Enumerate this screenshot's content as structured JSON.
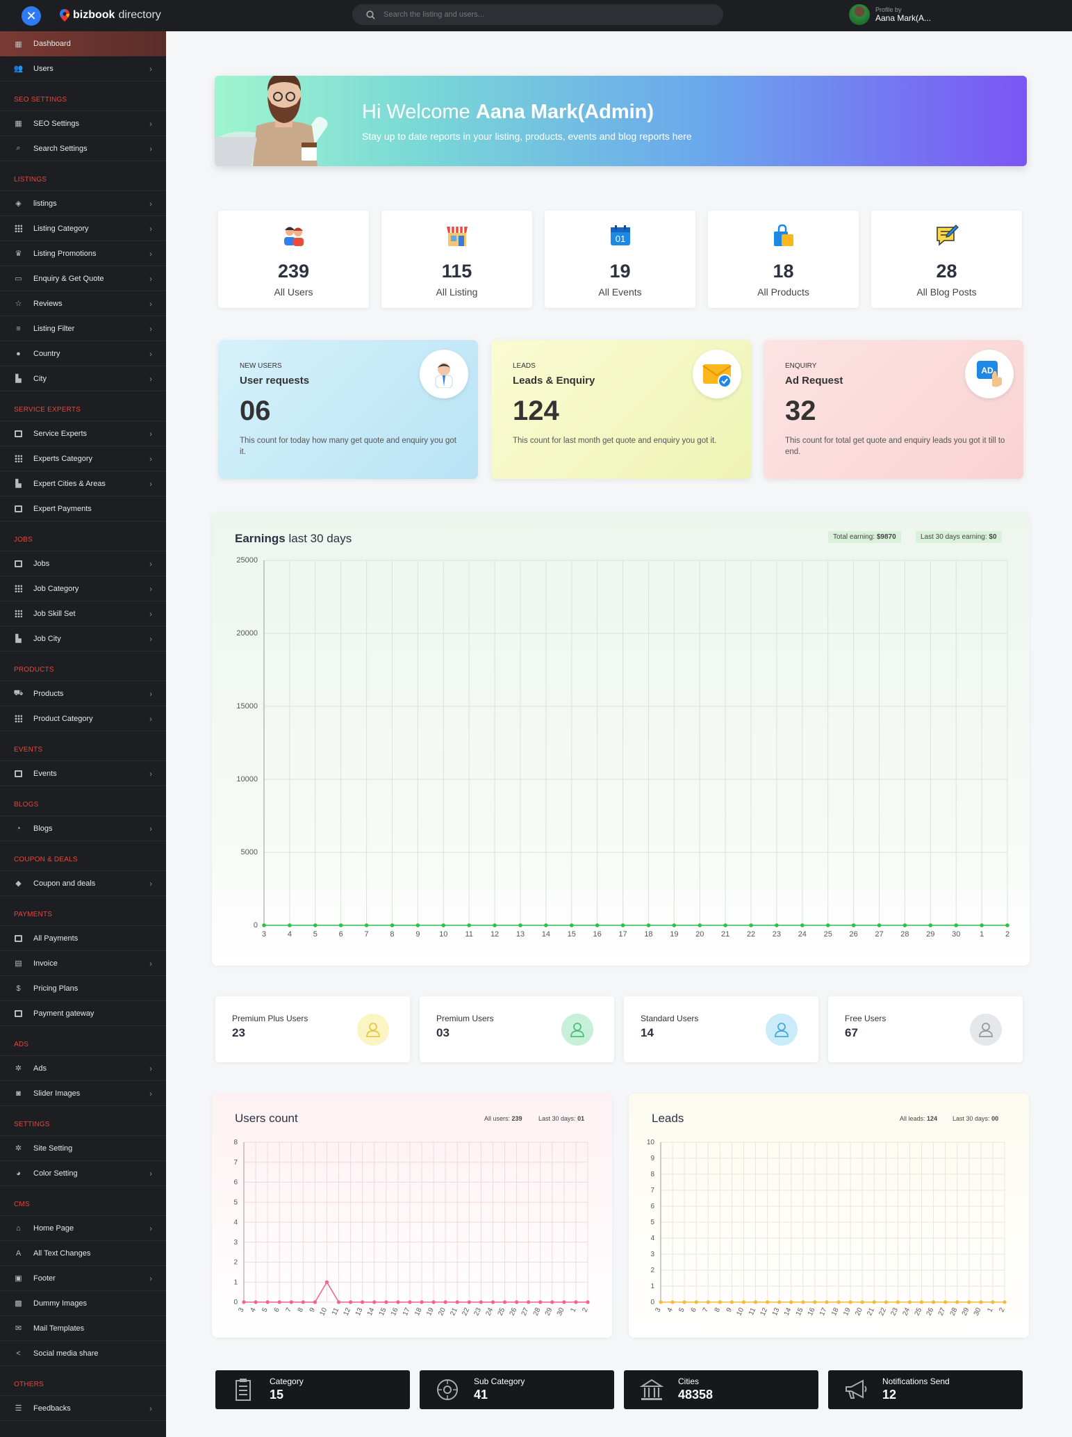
{
  "header": {
    "logo_bold": "bizbook",
    "logo_light": "directory",
    "search_placeholder": "Search the listing and users...",
    "profile_small": "Profile by",
    "profile_name": "Aana Mark(A..."
  },
  "sidebar": [
    {
      "label": "Dashboard",
      "icon": "dashboard-icon",
      "active": true
    },
    {
      "label": "Users",
      "icon": "users-icon",
      "chev": true
    },
    {
      "head": "SEO SETTINGS"
    },
    {
      "label": "SEO Settings",
      "icon": "seo-icon",
      "chev": true
    },
    {
      "label": "Search Settings",
      "icon": "search-settings-icon",
      "chev": true
    },
    {
      "head": "LISTINGS"
    },
    {
      "label": "listings",
      "icon": "layers-icon",
      "chev": true
    },
    {
      "label": "Listing Category",
      "icon": "grid-icon",
      "chev": true
    },
    {
      "label": "Listing Promotions",
      "icon": "trophy-icon",
      "chev": true
    },
    {
      "label": "Enquiry & Get Quote",
      "icon": "message-icon",
      "chev": true
    },
    {
      "label": "Reviews",
      "icon": "star-icon",
      "chev": true
    },
    {
      "label": "Listing Filter",
      "icon": "filter-icon",
      "chev": true
    },
    {
      "label": "Country",
      "icon": "location-icon",
      "chev": true
    },
    {
      "label": "City",
      "icon": "city-icon",
      "chev": true
    },
    {
      "head": "SERVICE EXPERTS"
    },
    {
      "label": "Service Experts",
      "icon": "calendar-icon",
      "chev": true
    },
    {
      "label": "Experts Category",
      "icon": "grid-icon",
      "chev": true
    },
    {
      "label": "Expert Cities & Areas",
      "icon": "city-icon",
      "chev": true
    },
    {
      "label": "Expert Payments",
      "icon": "card-icon",
      "chev": false
    },
    {
      "head": "JOBS"
    },
    {
      "label": "Jobs",
      "icon": "calendar-icon",
      "chev": true
    },
    {
      "label": "Job Category",
      "icon": "grid-icon",
      "chev": true
    },
    {
      "label": "Job Skill Set",
      "icon": "grid-icon",
      "chev": true
    },
    {
      "label": "Job City",
      "icon": "city-icon",
      "chev": true
    },
    {
      "head": "PRODUCTS"
    },
    {
      "label": "Products",
      "icon": "cart-icon",
      "chev": true
    },
    {
      "label": "Product Category",
      "icon": "grid-icon",
      "chev": true
    },
    {
      "head": "EVENTS"
    },
    {
      "label": "Events",
      "icon": "calendar-icon",
      "chev": true
    },
    {
      "head": "BLOGS"
    },
    {
      "label": "Blogs",
      "icon": "rss-icon",
      "chev": true
    },
    {
      "head": "COUPON & DEALS"
    },
    {
      "label": "Coupon and deals",
      "icon": "tag-icon",
      "chev": true
    },
    {
      "head": "PAYMENTS"
    },
    {
      "label": "All Payments",
      "icon": "card-icon",
      "chev": false
    },
    {
      "label": "Invoice",
      "icon": "invoice-icon",
      "chev": true
    },
    {
      "label": "Pricing Plans",
      "icon": "dollar-icon",
      "chev": false
    },
    {
      "label": "Payment gateway",
      "icon": "card-icon",
      "chev": false
    },
    {
      "head": "ADS"
    },
    {
      "label": "Ads",
      "icon": "gear-icon",
      "chev": true
    },
    {
      "label": "Slider Images",
      "icon": "camera-icon",
      "chev": true
    },
    {
      "head": "SETTINGS"
    },
    {
      "label": "Site Setting",
      "icon": "gear-icon",
      "chev": false
    },
    {
      "label": "Color Setting",
      "icon": "palette-icon",
      "chev": true
    },
    {
      "head": "CMS"
    },
    {
      "label": "Home Page",
      "icon": "home-icon",
      "chev": true
    },
    {
      "label": "All Text Changes",
      "icon": "text-icon",
      "chev": false
    },
    {
      "label": "Footer",
      "icon": "footer-icon",
      "chev": true
    },
    {
      "label": "Dummy Images",
      "icon": "image-icon",
      "chev": false
    },
    {
      "label": "Mail Templates",
      "icon": "mail-icon",
      "chev": false
    },
    {
      "label": "Social media share",
      "icon": "share-icon",
      "chev": false
    },
    {
      "head": "OTHERS"
    },
    {
      "label": "Feedbacks",
      "icon": "feedback-icon",
      "chev": true
    }
  ],
  "banner": {
    "greeting": "Hi Welcome",
    "name": "Aana Mark(Admin)",
    "subtitle": "Stay up to date reports in your listing, products, events and blog reports here"
  },
  "stats": [
    {
      "value": "239",
      "label": "All Users",
      "icon": "users-icon"
    },
    {
      "value": "115",
      "label": "All Listing",
      "icon": "shop-icon"
    },
    {
      "value": "19",
      "label": "All Events",
      "icon": "calendar-icon"
    },
    {
      "value": "18",
      "label": "All Products",
      "icon": "shopping-bag-icon"
    },
    {
      "value": "28",
      "label": "All Blog Posts",
      "icon": "blog-icon"
    }
  ],
  "info_cards": [
    {
      "tag": "NEW USERS",
      "title": "User requests",
      "value": "06",
      "desc": "This count for today how many get quote and enquiry you got it.",
      "icon": "user-avatar-icon",
      "bg": "#c9ecf8"
    },
    {
      "tag": "LEADS",
      "title": "Leads & Enquiry",
      "value": "124",
      "desc": "This count for last month get quote and enquiry you got it.",
      "icon": "mail-check-icon",
      "bg": "#f5f7c4"
    },
    {
      "tag": "ENQUIRY",
      "title": "Ad Request",
      "value": "32",
      "desc": "This count for total get quote and enquiry leads you got it till to end.",
      "icon": "ad-click-icon",
      "bg": "#fbdcdc"
    }
  ],
  "earnings": {
    "title_bold": "Earnings",
    "title_rest": "last 30 days",
    "total_label": "Total earning:",
    "total_value": "$9870",
    "last30_label": "Last 30 days earning:",
    "last30_value": "$0"
  },
  "tiers": [
    {
      "label": "Premium Plus Users",
      "value": "23",
      "color": "#fbf5c4",
      "icon_color": "#e8c64a"
    },
    {
      "label": "Premium Users",
      "value": "03",
      "color": "#c8f0d8",
      "icon_color": "#4bbf7c"
    },
    {
      "label": "Standard Users",
      "value": "14",
      "color": "#c9ecf8",
      "icon_color": "#47a9d9"
    },
    {
      "label": "Free Users",
      "value": "67",
      "color": "#e5e7ea",
      "icon_color": "#999"
    }
  ],
  "users_count": {
    "title": "Users count",
    "all_label": "All users:",
    "all_value": "239",
    "last_label": "Last 30 days:",
    "last_value": "01"
  },
  "leads": {
    "title": "Leads",
    "all_label": "All leads:",
    "all_value": "124",
    "last_label": "Last 30 days:",
    "last_value": "00"
  },
  "bottom": [
    {
      "label": "Category",
      "value": "15",
      "icon": "category-icon"
    },
    {
      "label": "Sub Category",
      "value": "41",
      "icon": "sub-category-icon"
    },
    {
      "label": "Cities",
      "value": "48358",
      "icon": "cities-icon"
    },
    {
      "label": "Notifications Send",
      "value": "12",
      "icon": "megaphone-icon"
    }
  ],
  "chart_data": [
    {
      "type": "line",
      "title": "Earnings last 30 days",
      "x": [
        "3",
        "4",
        "5",
        "6",
        "7",
        "8",
        "9",
        "10",
        "11",
        "12",
        "13",
        "14",
        "15",
        "16",
        "17",
        "18",
        "19",
        "20",
        "21",
        "22",
        "23",
        "24",
        "25",
        "26",
        "27",
        "28",
        "29",
        "30",
        "1",
        "2"
      ],
      "series": [
        {
          "values": [
            0,
            0,
            0,
            0,
            0,
            0,
            0,
            0,
            0,
            0,
            0,
            0,
            0,
            0,
            0,
            0,
            0,
            0,
            0,
            0,
            0,
            0,
            0,
            0,
            0,
            0,
            0,
            0,
            0,
            0
          ]
        }
      ],
      "ylim": [
        0,
        25000
      ],
      "yticks": [
        0,
        5000,
        10000,
        15000,
        20000,
        25000
      ],
      "color": "#2fbf4a",
      "grid": true
    },
    {
      "type": "line",
      "title": "Users count",
      "x": [
        "3",
        "4",
        "5",
        "6",
        "7",
        "8",
        "9",
        "10",
        "11",
        "12",
        "13",
        "14",
        "15",
        "16",
        "17",
        "18",
        "19",
        "20",
        "21",
        "22",
        "23",
        "24",
        "25",
        "26",
        "27",
        "28",
        "29",
        "30",
        "1",
        "2"
      ],
      "series": [
        {
          "values": [
            0,
            0,
            0,
            0,
            0,
            0,
            0,
            1,
            0,
            0,
            0,
            0,
            0,
            0,
            0,
            0,
            0,
            0,
            0,
            0,
            0,
            0,
            0,
            0,
            0,
            0,
            0,
            0,
            0,
            0
          ]
        }
      ],
      "ylim": [
        0,
        8
      ],
      "yticks": [
        0,
        1,
        2,
        3,
        4,
        5,
        6,
        7,
        8
      ],
      "color": "#f06292",
      "grid": true
    },
    {
      "type": "line",
      "title": "Leads",
      "x": [
        "3",
        "4",
        "5",
        "6",
        "7",
        "8",
        "9",
        "10",
        "11",
        "12",
        "13",
        "14",
        "15",
        "16",
        "17",
        "18",
        "19",
        "20",
        "21",
        "22",
        "23",
        "24",
        "25",
        "26",
        "27",
        "28",
        "29",
        "30",
        "1",
        "2"
      ],
      "series": [
        {
          "values": [
            0,
            0,
            0,
            0,
            0,
            0,
            0,
            0,
            0,
            0,
            0,
            0,
            0,
            0,
            0,
            0,
            0,
            0,
            0,
            0,
            0,
            0,
            0,
            0,
            0,
            0,
            0,
            0,
            0,
            0
          ]
        }
      ],
      "ylim": [
        0,
        10
      ],
      "yticks": [
        0,
        1,
        2,
        3,
        4,
        5,
        6,
        7,
        8,
        9,
        10
      ],
      "color": "#f6b93b",
      "grid": true
    }
  ]
}
